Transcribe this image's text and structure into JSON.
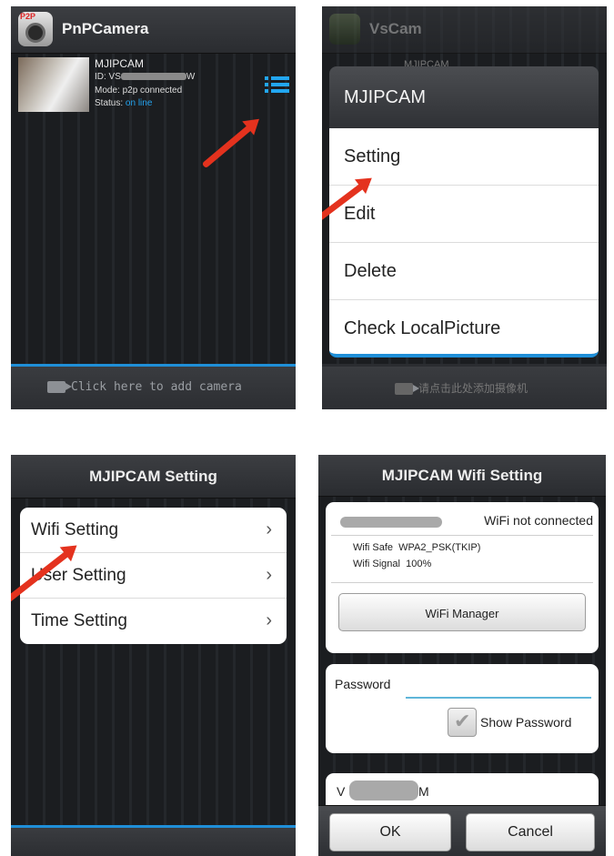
{
  "panel1": {
    "app_title": "PnPCamera",
    "logo_text": "P2P",
    "camera": {
      "name": "MJIPCAM",
      "id_label": "ID: VS",
      "id_suffix": "W",
      "mode": "Mode: p2p connected",
      "status_label": "Status:",
      "status_value": "on line"
    },
    "add_camera": "Click here to add camera",
    "colors": {
      "accent": "#1f8fd8",
      "arrow": "#e4321e"
    }
  },
  "panel2": {
    "app_title": "VsCam",
    "bg_camera_name": "MJIPCAM",
    "menu_title": "MJIPCAM",
    "menu_items": [
      "Setting",
      "Edit",
      "Delete",
      "Check LocalPicture"
    ],
    "add_camera": "请点击此处添加摄像机"
  },
  "panel3": {
    "title": "MJIPCAM  Setting",
    "items": [
      "Wifi Setting",
      "User Setting",
      "Time Setting"
    ]
  },
  "panel4": {
    "title": "MJIPCAM  Wifi Setting",
    "wifi_status": "WiFi not connected",
    "wifi_safe_label": "Wifi Safe",
    "wifi_safe_value": "WPA2_PSK(TKIP)",
    "wifi_signal_label": "Wifi Signal",
    "wifi_signal_value": "100%",
    "wifi_manager_label": "WiFi Manager",
    "password_label": "Password",
    "password_value": "",
    "show_password_label": "Show Password",
    "show_password_checked": true,
    "ssid_prefix": "V",
    "ssid_suffix": "M",
    "ok_label": "OK",
    "cancel_label": "Cancel"
  }
}
